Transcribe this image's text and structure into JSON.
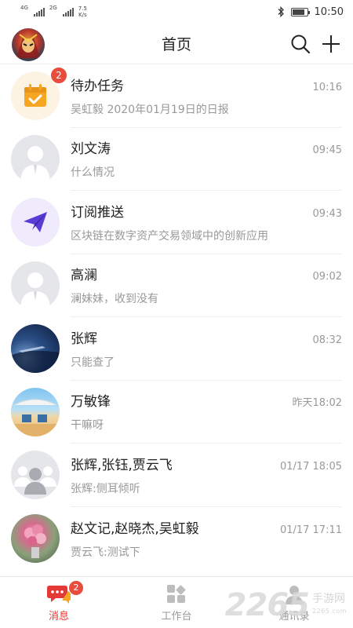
{
  "status_bar": {
    "sim1_label": "4G",
    "sim2_label": "2G",
    "net_speed_value": "7.5",
    "net_speed_unit": "K/s",
    "time": "10:50"
  },
  "header": {
    "title": "首页"
  },
  "conversations": [
    {
      "name": "待办任务",
      "time": "10:16",
      "preview": "吴虹毅 2020年01月19日的日报",
      "badge": "2",
      "avatar": "todo-calendar-icon"
    },
    {
      "name": "刘文涛",
      "time": "09:45",
      "preview": "什么情况",
      "badge": "",
      "avatar": "default-person-avatar"
    },
    {
      "name": "订阅推送",
      "time": "09:43",
      "preview": "区块链在数字资产交易领域中的创新应用",
      "badge": "",
      "avatar": "paper-plane-icon"
    },
    {
      "name": "高澜",
      "time": "09:02",
      "preview": "澜妹妹，收到没有",
      "badge": "",
      "avatar": "default-person-avatar"
    },
    {
      "name": "张辉",
      "time": "08:32",
      "preview": "只能查了",
      "badge": "",
      "avatar": "photo-avatar"
    },
    {
      "name": "万敏锋",
      "time": "昨天18:02",
      "preview": "干嘛呀",
      "badge": "",
      "avatar": "photo-avatar"
    },
    {
      "name": "张辉,张钰,贾云飞",
      "time": "01/17 18:05",
      "preview": "张辉:侧耳倾听",
      "badge": "",
      "avatar": "group-avatar"
    },
    {
      "name": "赵文记,赵晓杰,吴虹毅",
      "time": "01/17 17:11",
      "preview": "贾云飞:测试下",
      "badge": "",
      "avatar": "photo-avatar"
    }
  ],
  "tabbar": {
    "tabs": [
      {
        "label": "消息",
        "badge": "2",
        "active": true
      },
      {
        "label": "工作台",
        "badge": "",
        "active": false
      },
      {
        "label": "通讯录",
        "badge": "",
        "active": false
      }
    ]
  },
  "watermark": {
    "number": "2265",
    "text": "手游网",
    "sub": "2265.com"
  },
  "colors": {
    "accent": "#e53935",
    "badge": "#e74c3c",
    "todo_orange": "#f5a623",
    "push_purple": "#5b3bd6"
  }
}
